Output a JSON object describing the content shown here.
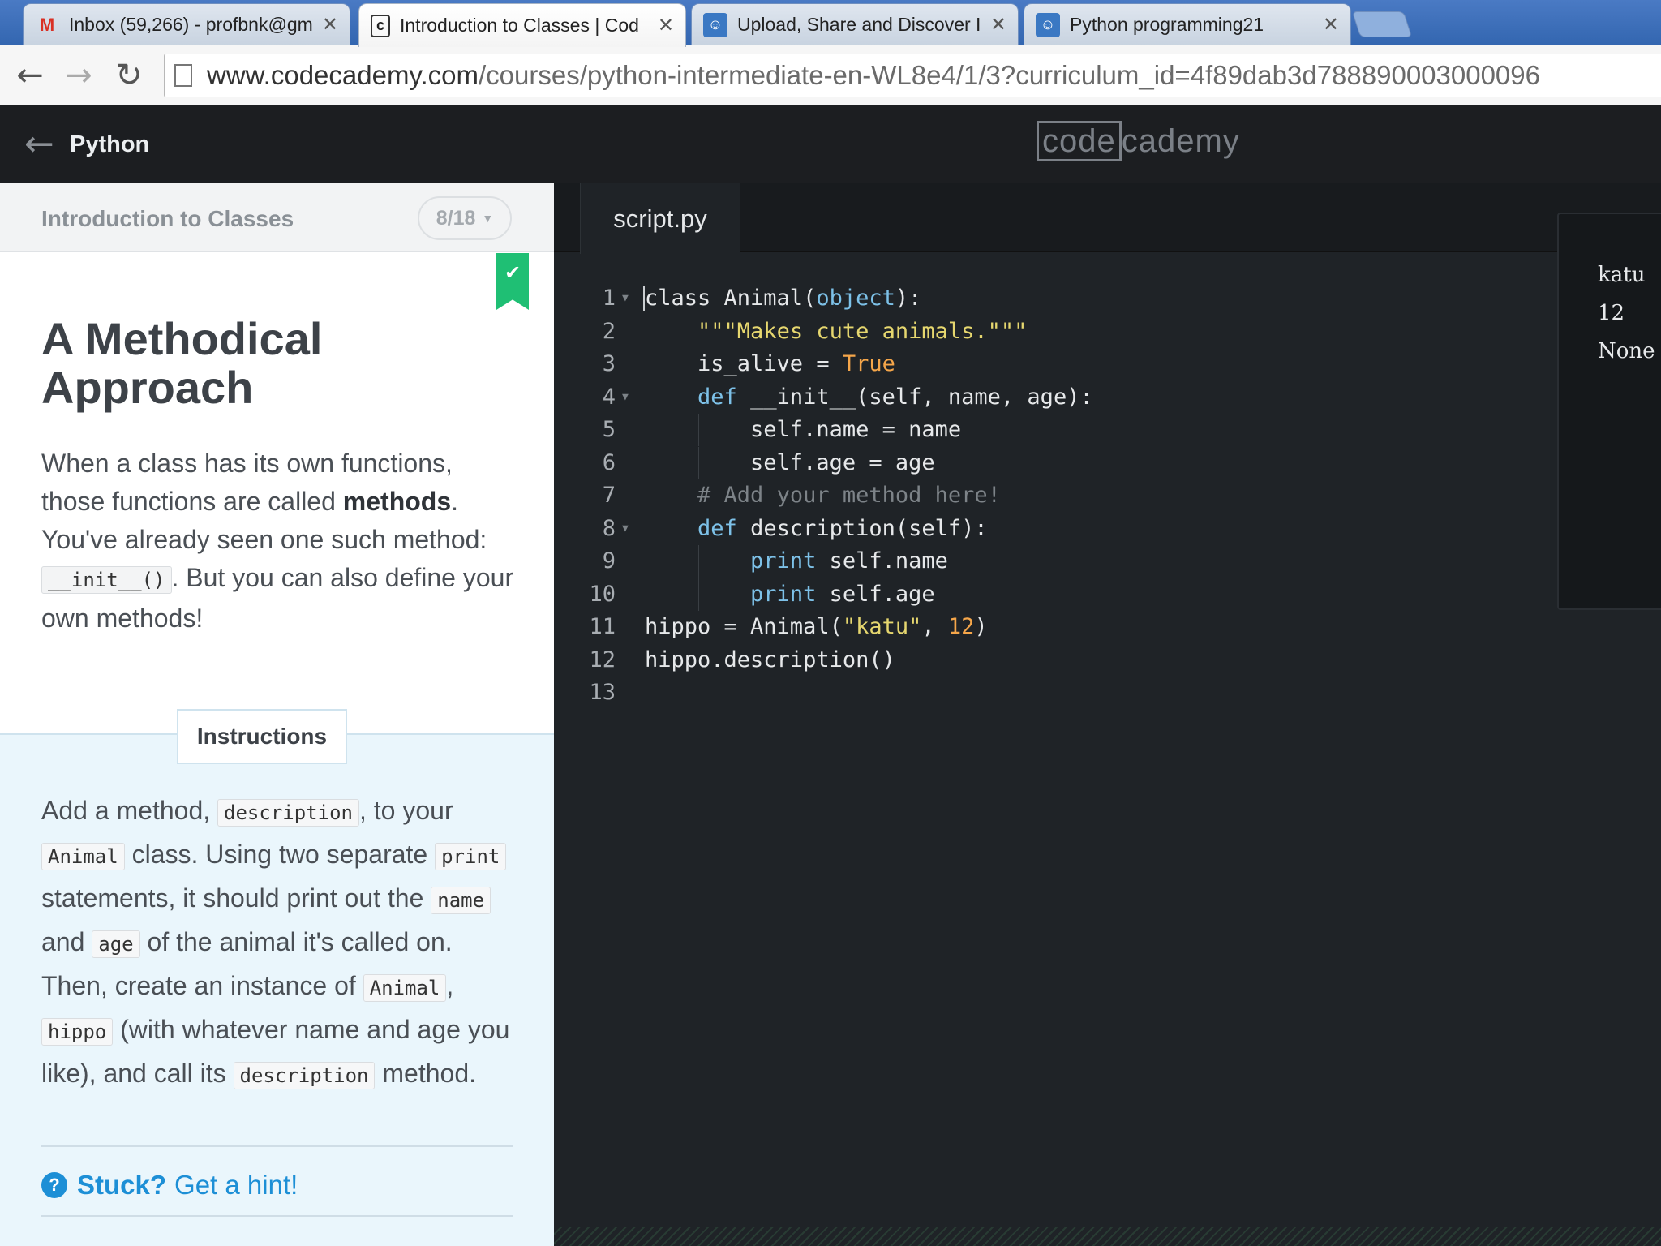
{
  "browser": {
    "tabs": [
      {
        "title": "Inbox (59,266) - profbnk@gm",
        "favicon": "gmail-icon",
        "active": false
      },
      {
        "title": "Introduction to Classes | Cod",
        "favicon": "codecademy-icon",
        "active": true
      },
      {
        "title": "Upload, Share and Discover I",
        "favicon": "slideshare-icon",
        "active": false
      },
      {
        "title": "Python programming21",
        "favicon": "slideshare-icon",
        "active": false
      }
    ],
    "url_domain": "www.codecademy.com",
    "url_path": "/courses/python-intermediate-en-WL8e4/1/3?curriculum_id=4f89dab3d788890003000096"
  },
  "header": {
    "course": "Python",
    "logo_boxed": "code",
    "logo_rest": "cademy"
  },
  "lesson": {
    "unit_title": "Introduction to Classes",
    "progress": "8/18",
    "heading": "A Methodical Approach",
    "para": {
      "t1": "When a class has its own functions, those functions are called ",
      "bold": "methods",
      "t2": ". You've already seen one such method: ",
      "code1": "__init__()",
      "t3": ". But you can also define your own methods!"
    },
    "instructions_label": "Instructions",
    "instructions": {
      "a": "Add a method, ",
      "c1": "description",
      "b": ", to your ",
      "c2": "Animal",
      "d": " class. Using two separate ",
      "c3": "print",
      "e": " statements, it should print out the ",
      "c4": "name",
      "f": " and ",
      "c5": "age",
      "g": " of the animal it's called on. Then, create an instance of ",
      "c6": "Animal",
      "h": ", ",
      "c7": "hippo",
      "i": " (with whatever name and age you like), and call its ",
      "c8": "description",
      "j": " method."
    },
    "hint_bold": "Stuck?",
    "hint_link": "Get a hint!"
  },
  "editor": {
    "file": "script.py",
    "line_numbers": [
      "1",
      "2",
      "3",
      "4",
      "5",
      "6",
      "7",
      "8",
      "9",
      "10",
      "11",
      "12",
      "13"
    ]
  },
  "output": {
    "lines": [
      "katu",
      "12",
      "None"
    ]
  },
  "colors": {
    "keyword": "#7dc1e8",
    "string": "#e6d76f",
    "number": "#f5a64a",
    "comment": "#7d8388",
    "bookmark": "#1fbf74",
    "hint": "#1d8fd6"
  }
}
